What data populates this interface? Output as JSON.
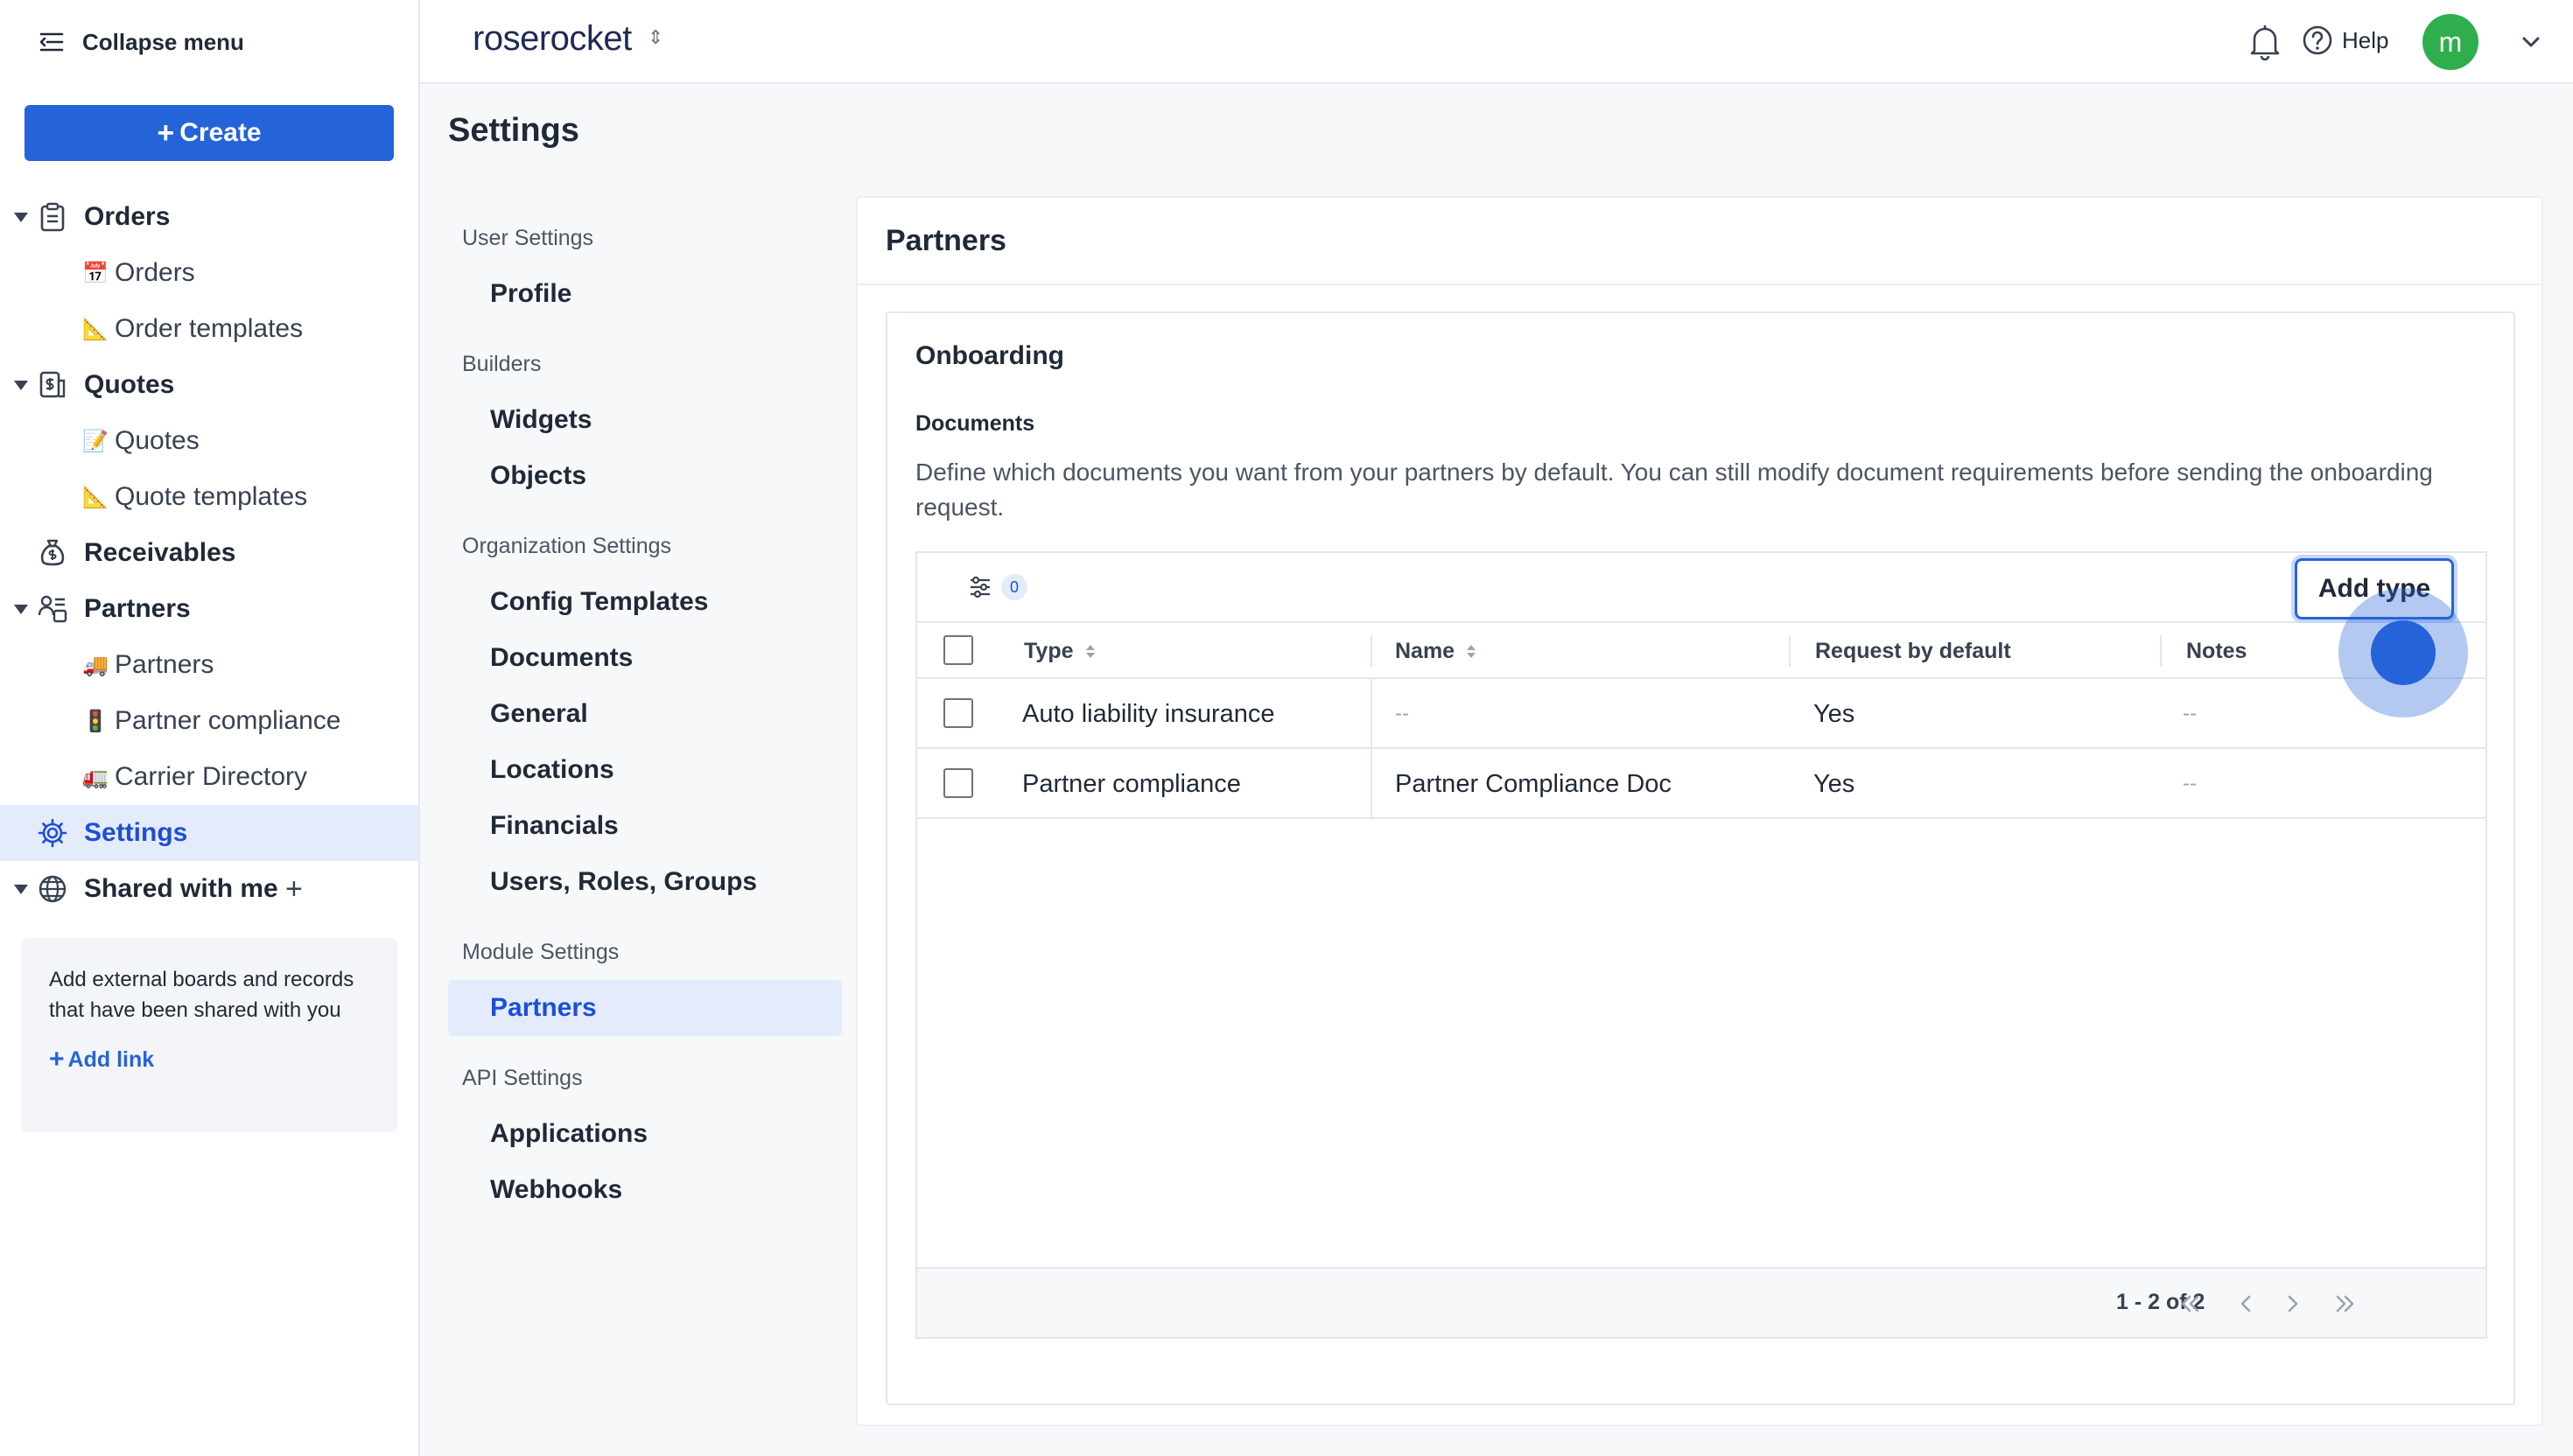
{
  "sidebar": {
    "collapse_label": "Collapse menu",
    "create_label": "Create",
    "items": [
      {
        "label": "Orders"
      },
      {
        "emoji": "📅",
        "label": "Orders"
      },
      {
        "emoji": "📐",
        "label": "Order templates"
      },
      {
        "label": "Quotes"
      },
      {
        "emoji": "📝",
        "label": "Quotes"
      },
      {
        "emoji": "📐",
        "label": "Quote templates"
      },
      {
        "label": "Receivables"
      },
      {
        "label": "Partners"
      },
      {
        "emoji": "🚚",
        "label": "Partners"
      },
      {
        "emoji": "🚦",
        "label": "Partner compliance"
      },
      {
        "emoji": "🚛",
        "label": "Carrier Directory"
      },
      {
        "label": "Settings"
      },
      {
        "label": "Shared with me"
      }
    ],
    "info_text": "Add external boards and records that have been shared with you",
    "add_link_label": "Add link"
  },
  "header": {
    "logo_text": "roserocket",
    "help_label": "Help",
    "avatar_initial": "m"
  },
  "settings": {
    "title": "Settings",
    "groups": [
      {
        "label": "User Settings",
        "items": [
          "Profile"
        ]
      },
      {
        "label": "Builders",
        "items": [
          "Widgets",
          "Objects"
        ]
      },
      {
        "label": "Organization Settings",
        "items": [
          "Config Templates",
          "Documents",
          "General",
          "Locations",
          "Financials",
          "Users, Roles, Groups"
        ]
      },
      {
        "label": "Module Settings",
        "items": [
          "Partners"
        ]
      },
      {
        "label": "API Settings",
        "items": [
          "Applications",
          "Webhooks"
        ]
      }
    ],
    "active_item": "Partners"
  },
  "content": {
    "panel_title": "Partners",
    "card_title": "Onboarding",
    "docs_label": "Documents",
    "docs_description": "Define which documents you want from your partners by default. You can still modify document requirements before sending the onboarding request.",
    "filter_count": "0",
    "add_type_label": "Add type",
    "table": {
      "columns": [
        "Type",
        "Name",
        "Request by default",
        "Notes"
      ],
      "rows": [
        {
          "type": "Auto liability insurance",
          "name": "--",
          "request_by_default": "Yes",
          "notes": "--"
        },
        {
          "type": "Partner compliance",
          "name": "Partner Compliance Doc",
          "request_by_default": "Yes",
          "notes": "--"
        }
      ]
    },
    "pagination": "1 - 2 of 2"
  },
  "colors": {
    "accent": "#2563d9",
    "avatar": "#2fae4d",
    "active_bg": "#e4ecfb"
  }
}
